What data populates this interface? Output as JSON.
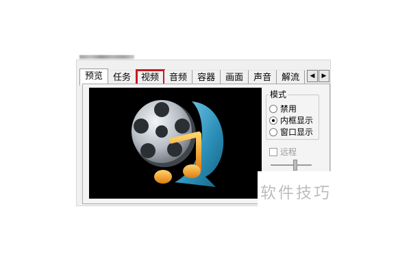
{
  "tabs": [
    {
      "label": "预览",
      "active": true
    },
    {
      "label": "任务"
    },
    {
      "label": "视频",
      "highlighted": true
    },
    {
      "label": "音频"
    },
    {
      "label": "容器"
    },
    {
      "label": "画面"
    },
    {
      "label": "声音"
    },
    {
      "label": "解流"
    }
  ],
  "tab_scroll": {
    "left_icon": "triangle-left-icon",
    "right_icon": "triangle-right-icon"
  },
  "mode_group": {
    "title": "模式",
    "options": [
      "禁用",
      "内框显示",
      "窗口显示"
    ],
    "selected": "内框显示"
  },
  "remote_checkbox": {
    "label": "远程",
    "checked": false,
    "enabled": false
  },
  "watermark": "软件技巧",
  "colors": {
    "highlight": "#c8191c",
    "preview_bg": "#000000",
    "panel_bg": "#f0f0f0",
    "reel": "#bfc4c9",
    "arc": "#3aa0c8",
    "note": "#f5a21a"
  },
  "preview_image": "film-reel-music-note-logo"
}
